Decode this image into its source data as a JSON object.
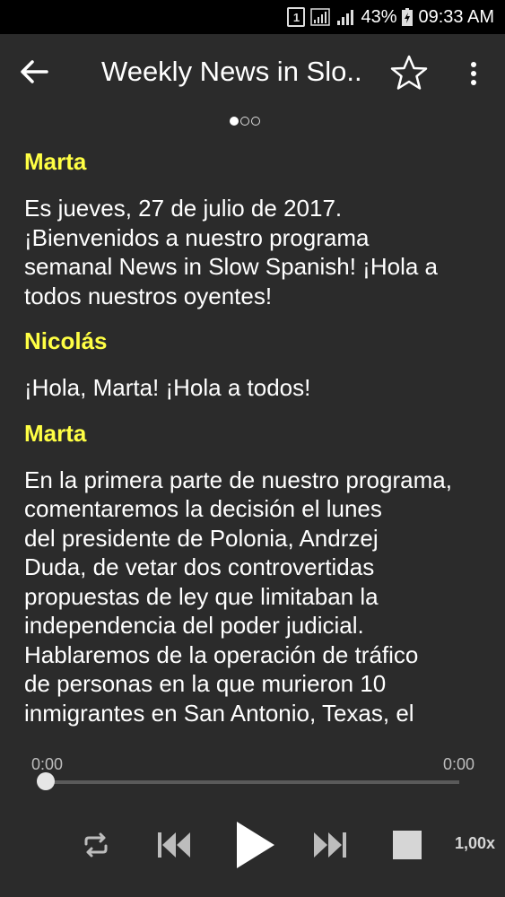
{
  "status_bar": {
    "sim": "1",
    "battery_percent": "43%",
    "time": "09:33 AM"
  },
  "app_bar": {
    "title": "Weekly News in Slo..",
    "icons": {
      "back": "arrow-back-icon",
      "favorite": "star-outline-icon",
      "menu": "more-vert-icon"
    }
  },
  "pager": {
    "pages": 3,
    "active": 0
  },
  "transcript": [
    {
      "speaker": "Marta",
      "text": "Es jueves, 27 de julio de 2017.\n¡Bienvenidos a nuestro programa\nsemanal News in Slow Spanish! ¡Hola a\ntodos nuestros oyentes!"
    },
    {
      "speaker": "Nicolás",
      "text": "¡Hola, Marta! ¡Hola a todos!"
    },
    {
      "speaker": "Marta",
      "text": "En la primera parte de nuestro programa,\ncomentaremos la decisión el lunes\ndel presidente de Polonia, Andrzej\nDuda, de vetar dos controvertidas\npropuestas de ley que limitaban la\nindependencia del poder judicial.\nHablaremos de la operación de tráfico\nde personas en la que murieron 10\ninmigrantes en San Antonio, Texas, el"
    }
  ],
  "player": {
    "elapsed": "0:00",
    "duration": "0:00",
    "progress": 0,
    "speed": "1,00x",
    "icons": {
      "repeat": "repeat-icon",
      "previous": "skip-previous-icon",
      "play": "play-icon",
      "next": "skip-next-icon",
      "stop": "stop-icon"
    }
  },
  "colors": {
    "background": "#2b2b2b",
    "speaker": "#ffff44",
    "text": "#ffffff"
  }
}
